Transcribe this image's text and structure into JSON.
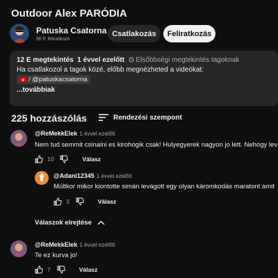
{
  "video": {
    "title": "Outdoor Alex PARÓDIA"
  },
  "channel": {
    "name": "Patuska Csatorna",
    "subscribers": "96 E feliratkozó",
    "join_label": "Csatlakozás",
    "subscribe_label": "Feliratkozás"
  },
  "description": {
    "views": "12 E megtekintés",
    "age": "1 évvel ezelőtt",
    "priority": "Elsőbbségi megtekintés tagoknak",
    "line1": "Ha csatlakozol a tagok közé, előbb megnézheted a videókat:",
    "link": "/ @patuskacsatorna",
    "more": "...továbbiak"
  },
  "comments_header": {
    "count": "225 hozzászólás",
    "sort_label": "Rendezési szempont"
  },
  "comments": [
    {
      "author": "@ReMekkElek",
      "time": "1 évvel ezelőtt",
      "text": "Nem tud semmit csinalni es kirohogik csak! Hulyegyerek nagyon jo lett. Nehogy lev",
      "likes": "10",
      "reply_label": "Válasz"
    },
    {
      "author": "@Adani12345",
      "time": "1 évvel ezelőtt",
      "text": "Múltkor mikor kiontotte simán levágott egy olyan káromkodás maratont amit",
      "likes": "3",
      "reply_label": "Válasz"
    },
    {
      "author": "@ReMekkElek",
      "time": "1 évvel ezelőtt",
      "text": "Te ez kurva jo!",
      "likes": "7",
      "reply_label": "Válasz"
    }
  ],
  "hide_replies_label": "Válaszok elrejtése",
  "icons": {
    "priority": "clock-icon",
    "sort": "sort-lines-icon",
    "like": "thumbs-up-icon",
    "dislike": "thumbs-down-icon",
    "collapse": "chevron-up-icon",
    "link": "youtube-icon"
  },
  "colors": {
    "background": "#0f0f0f",
    "card": "#272727",
    "text": "#f1f1f1",
    "muted": "#aaaaaa",
    "subscribe_bg": "#f1f1f1"
  }
}
